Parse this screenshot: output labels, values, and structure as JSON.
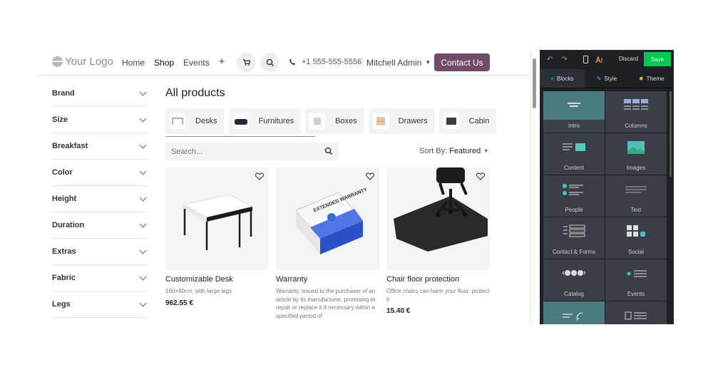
{
  "header": {
    "logo": "Your Logo",
    "nav": [
      "Home",
      "Shop",
      "Events"
    ],
    "active_nav": "Shop",
    "add_icon": "+",
    "phone": "+1 555-555-5556",
    "user": "Mitchell Admin",
    "contact_label": "Contact Us",
    "accent": "#714b67"
  },
  "filters": [
    "Brand",
    "Size",
    "Breakfast",
    "Color",
    "Height",
    "Duration",
    "Extras",
    "Fabric",
    "Legs"
  ],
  "main": {
    "title": "All products",
    "categories": [
      "Desks",
      "Furnitures",
      "Boxes",
      "Drawers",
      "Cabin"
    ],
    "search_placeholder": "Search...",
    "sort_prefix": "Sort By:",
    "sort_value": "Featured"
  },
  "products": [
    {
      "name": "Customizable Desk",
      "desc": "160×80cm, with large legs",
      "price": "962.55 €"
    },
    {
      "name": "Warranty",
      "desc": "Warranty, issued to the purchaser of an article by its manufacturer, promising to repair or replace it if necessary within a specified period of",
      "price": ""
    },
    {
      "name": "Chair floor protection",
      "desc": "Office chairs can harm your floor: protect it",
      "price": "15.40 €"
    }
  ],
  "warranty_box_text": "EXTENDED WARRANTY",
  "editor": {
    "discard": "Discard",
    "save": "Save",
    "save_color": "#00c851",
    "tabs": [
      "Blocks",
      "Style",
      "Theme"
    ],
    "blocks": [
      "Intro",
      "Columns",
      "Content",
      "Images",
      "People",
      "Text",
      "Contact & Forms",
      "Social",
      "Catalog",
      "Events",
      "",
      ""
    ]
  }
}
